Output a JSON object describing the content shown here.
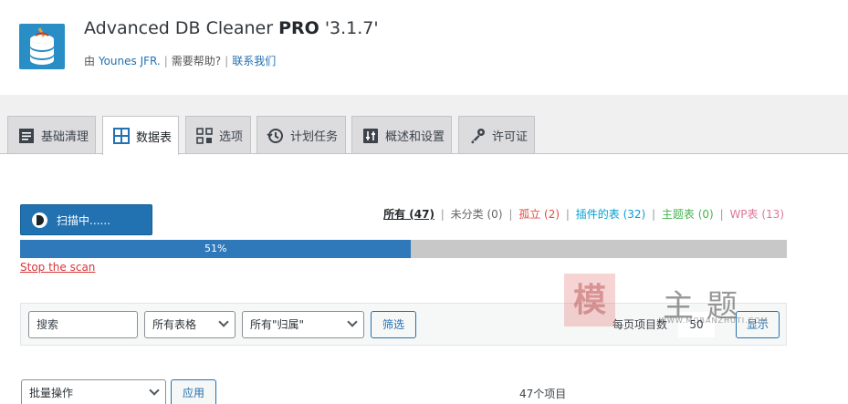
{
  "plugin": {
    "name": "Advanced DB Cleaner ",
    "edition": "PRO",
    "version": " '3.1.7'",
    "by_prefix": "由 ",
    "author": "Younes JFR.",
    "help_label": "需要帮助?",
    "contact_label": "联系我们"
  },
  "tabs": [
    {
      "label": "基础清理",
      "icon": "document-lines-icon"
    },
    {
      "label": "数据表",
      "icon": "table-grid-icon",
      "active": true
    },
    {
      "label": "选项",
      "icon": "options-grid-icon"
    },
    {
      "label": "计划任务",
      "icon": "history-clock-icon"
    },
    {
      "label": "概述和设置",
      "icon": "sliders-icon"
    },
    {
      "label": "许可证",
      "icon": "key-icon"
    }
  ],
  "scan": {
    "button_label": "扫描中......",
    "progress_percent": 51,
    "progress_label": "51%",
    "stop_label": "Stop the scan"
  },
  "filters": [
    {
      "label": "所有",
      "count": " (47)",
      "color": "#23282d"
    },
    {
      "label": "未分类",
      "count": " (0)",
      "color": "#666666"
    },
    {
      "label": "孤立",
      "count": " (2)",
      "color": "#e14d43"
    },
    {
      "label": "插件的表",
      "count": " (32)",
      "color": "#00a0d2"
    },
    {
      "label": "主题表",
      "count": " (0)",
      "color": "#46b450"
    },
    {
      "label": "WP表",
      "count": " (13)",
      "color": "#dd7799"
    }
  ],
  "toolbar": {
    "search_placeholder": "搜索",
    "table_select": "所有表格",
    "owner_select": "所有\"归属\"",
    "filter_button": "筛选",
    "per_page_label": "每页项目数",
    "per_page_value": "50",
    "show_button": "显示"
  },
  "bulk": {
    "select_label": "批量操作",
    "apply_button": "应用",
    "items_count": "47个项目"
  },
  "watermark": {
    "stamp": "模",
    "chars": "主题",
    "url": "WWW.MOBANZHUTI.COM"
  }
}
